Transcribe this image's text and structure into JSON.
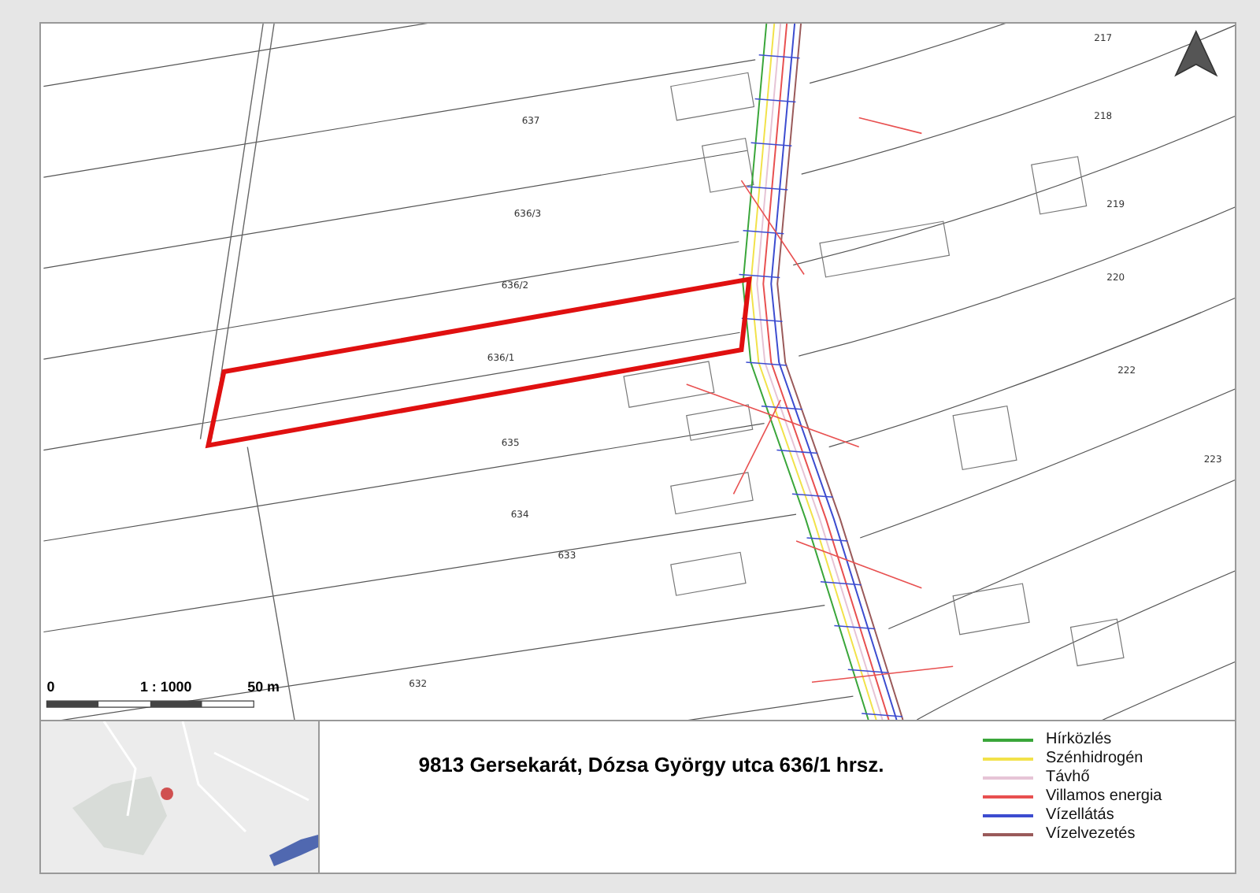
{
  "map": {
    "parcel_labels": [
      {
        "text": "637"
      },
      {
        "text": "636/3"
      },
      {
        "text": "636/2"
      },
      {
        "text": "636/1"
      },
      {
        "text": "635"
      },
      {
        "text": "634"
      },
      {
        "text": "633"
      },
      {
        "text": "632"
      },
      {
        "text": "217"
      },
      {
        "text": "218"
      },
      {
        "text": "219"
      },
      {
        "text": "220"
      },
      {
        "text": "222"
      },
      {
        "text": "223"
      }
    ],
    "scale_bar": {
      "start": "0",
      "ratio": "1 : 1000",
      "end": "50 m"
    }
  },
  "title": "9813 Gersekarát, Dózsa György utca 636/1 hrsz.",
  "legend": [
    {
      "label": "Hírközlés",
      "color": "#3aa63a"
    },
    {
      "label": "Szénhidrogén",
      "color": "#f2e24a"
    },
    {
      "label": "Távhő",
      "color": "#e6c4d6"
    },
    {
      "label": "Villamos energia",
      "color": "#e85050"
    },
    {
      "label": "Vízellátás",
      "color": "#3c4cd0"
    },
    {
      "label": "Vízelvezetés",
      "color": "#9a5a5a"
    }
  ]
}
